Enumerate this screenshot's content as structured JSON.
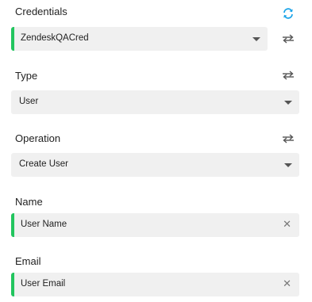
{
  "credentials": {
    "label": "Credentials",
    "value": "ZendeskQACred"
  },
  "type": {
    "label": "Type",
    "value": "User"
  },
  "operation": {
    "label": "Operation",
    "value": "Create User"
  },
  "name": {
    "label": "Name",
    "value": "User Name"
  },
  "email": {
    "label": "Email",
    "value": "User Email"
  },
  "icons": {
    "refresh": "refresh-icon",
    "swap": "swap-arrows-icon",
    "dropdown": "chevron-down-icon",
    "clear": "close-icon"
  },
  "colors": {
    "required_accent": "#22c55e",
    "refresh_icon": "#1aa3e8",
    "field_bg": "#f0f0f0"
  }
}
